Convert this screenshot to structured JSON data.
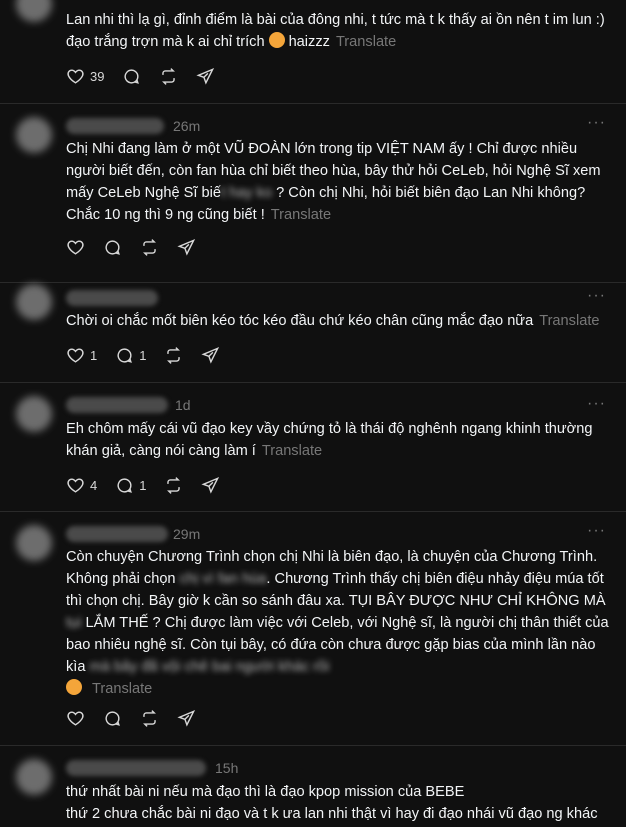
{
  "posts": [
    {
      "text": "Lan nhi thì lạ gì, đỉnh điểm là bài của đông nhi, t tức mà t k thấy ai ồn nên t im lun :) đạo trắng trợn mà k ai chỉ trích",
      "text_tail": "haizzz",
      "translate": "Translate",
      "likes": "39"
    },
    {
      "time": "26m",
      "text": "Chị Nhi đang làm ở một VŨ ĐOÀN lớn trong tip VIỆT NAM ấy ! Chỉ được nhiều người biết đến, còn fan hùa chỉ biết theo hùa, bây thử hỏi CeLeb, hỏi Nghệ Sĩ xem mấy CeLeb Nghệ Sĩ biế",
      "hidden": "t hay ko",
      "text2": "? Còn chị Nhi, hỏi biết biên đạo Lan Nhi không? Chắc 10 ng thì 9 ng cũng biết !",
      "translate": "Translate"
    },
    {
      "text": "Chời oi chắc mốt biên kéo tóc kéo đầu chứ kéo chân cũng mắc đạo nữa",
      "translate": "Translate",
      "likes": "1",
      "replies": "1"
    },
    {
      "time": "1d",
      "text": "Eh chôm mấy cái vũ đạo key vầy chứng tỏ là thái độ nghênh ngang khinh thường khán giả, càng nói càng làm í",
      "translate": "Translate",
      "likes": "4",
      "replies": "1"
    },
    {
      "time": "29m",
      "text_a": "Còn chuyện Chương Trình chọn chị Nhi là biên đạo, là chuyện của Chương Trình. Không phải chọn",
      "text_b": ". Chương Trình thấy chị biên điệu nhảy điệu múa tốt thì chọn chị. Bây giờ k cần so sánh đâu xa. TỤI BÂY ĐƯỢC NHƯ CHỈ KHÔNG MÀ",
      "text_c": "LẮM THẾ ? Chị được làm việc với Celeb, với Nghệ sĩ, là người chị thân thiết của bao nhiêu nghệ sĩ. Còn tụi bây, có đứa còn chưa được gặp bias của mình lần nào kìa",
      "translate": "Translate"
    },
    {
      "time": "15h",
      "text": "thứ nhất bài ni nếu mà đạo thì là đạo kpop mission của BEBE",
      "text2": "thứ 2 chưa chắc bài ni đạo và t k ưa lan nhi thật vì hay đi đạo nhái vũ đạo ng khác"
    }
  ]
}
